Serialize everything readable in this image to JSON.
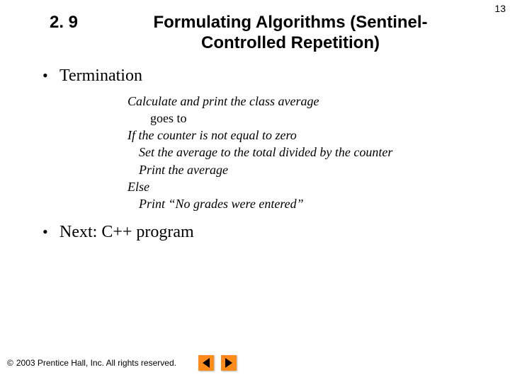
{
  "page_number": "13",
  "header": {
    "section_number": "2. 9",
    "section_title": "Formulating Algorithms (Sentinel-Controlled Repetition)"
  },
  "bullets": {
    "b1": "Termination",
    "b2": "Next: C++ program"
  },
  "pseudo": {
    "l1": "Calculate and print the class average",
    "l2": "goes to",
    "l3": "If the counter is not equal to zero",
    "l4": "Set the average to the total divided by the counter",
    "l5": "Print the average",
    "l6": "Else",
    "l7": "Print “No grades were entered”"
  },
  "footer": {
    "symbol": "©",
    "text": "2003 Prentice Hall, Inc. All rights reserved."
  },
  "nav": {
    "prev": "Previous slide",
    "next": "Next slide"
  }
}
